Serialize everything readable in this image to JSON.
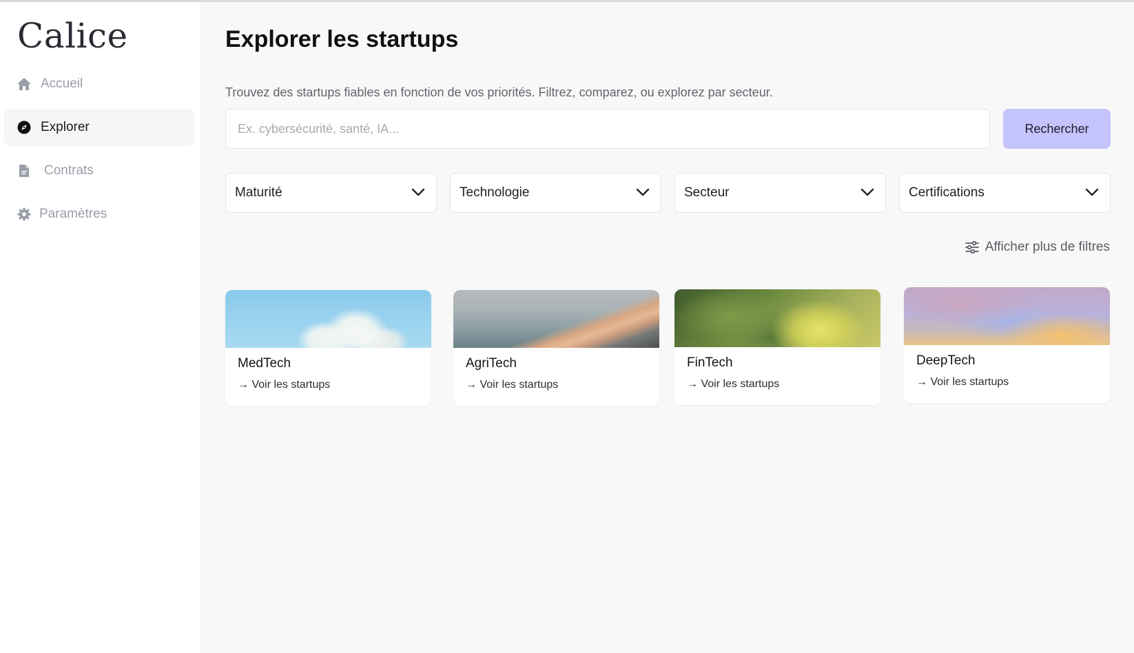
{
  "sidebar": {
    "logo": "Calice",
    "items": [
      {
        "label": "Accueil",
        "icon": "home-icon",
        "active": false
      },
      {
        "label": "Explorer",
        "icon": "compass-icon",
        "active": true
      },
      {
        "label": "Contrats",
        "icon": "document-icon",
        "active": false
      },
      {
        "label": "Paramètres",
        "icon": "gear-icon",
        "active": false
      }
    ]
  },
  "main": {
    "title": "Explorer les startups",
    "subtitle": "Trouvez des startups fiables en fonction de vos priorités. Filtrez, comparez, ou explorez par secteur.",
    "search": {
      "placeholder": "Ex. cybersécurité, santé, IA...",
      "value": "",
      "button_label": "Rechercher"
    },
    "filters": [
      {
        "label": "Maturité"
      },
      {
        "label": "Technologie"
      },
      {
        "label": "Secteur"
      },
      {
        "label": "Certifications"
      }
    ],
    "more_filters_label": "Afficher plus de filtres",
    "sectors": [
      {
        "name": "MedTech",
        "link": "→ Voir les startups"
      },
      {
        "name": "AgriTech",
        "link": "→ Voir les startups"
      },
      {
        "name": "FinTech",
        "link": "→ Voir les startups"
      },
      {
        "name": "DeepTech",
        "link": "→ Voir les startups"
      }
    ]
  },
  "colors": {
    "accent_button": "#c5c3fb",
    "page_background": "#f8f8f8",
    "sidebar_background": "#ffffff",
    "active_nav_background": "#f6f6f6",
    "muted_text": "#9a9ea8"
  }
}
